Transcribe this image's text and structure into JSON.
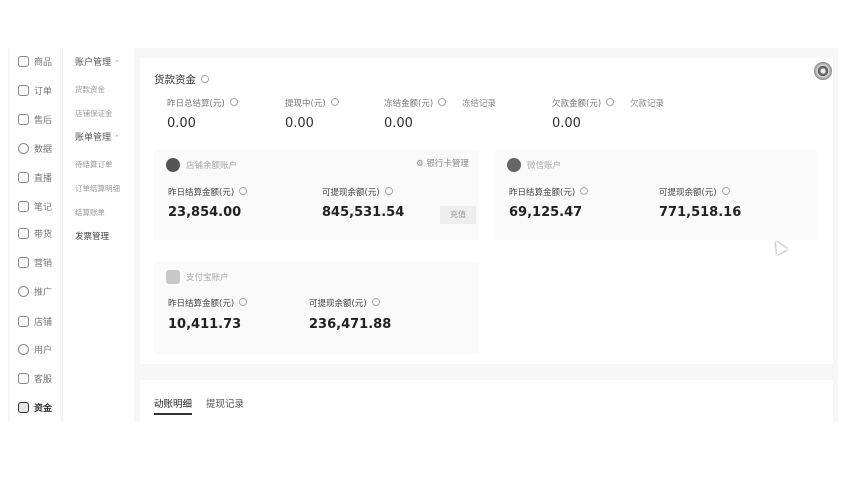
{
  "nav": {
    "items": [
      {
        "label": "商品",
        "icon": "box-icon"
      },
      {
        "label": "订单",
        "icon": "clipboard-icon"
      },
      {
        "label": "售后",
        "icon": "service-icon"
      },
      {
        "label": "数据",
        "icon": "chart-icon"
      },
      {
        "label": "直播",
        "icon": "live-icon"
      },
      {
        "label": "笔记",
        "icon": "book-icon"
      },
      {
        "label": "带货",
        "icon": "lock-icon"
      },
      {
        "label": "营销",
        "icon": "megaphone-icon"
      },
      {
        "label": "推广",
        "icon": "people-icon"
      },
      {
        "label": "店铺",
        "icon": "shop-icon"
      },
      {
        "label": "用户",
        "icon": "user-icon"
      },
      {
        "label": "客服",
        "icon": "chat-icon"
      },
      {
        "label": "资金",
        "icon": "wallet-icon"
      }
    ]
  },
  "submenu": {
    "account_head": "账户管理",
    "account_items": [
      "货款资金",
      "店铺保证金"
    ],
    "bill_head": "账单管理",
    "bill_items": [
      "待结算订单",
      "订单结算明细",
      "结算账单"
    ],
    "invoice": "发票管理"
  },
  "funds": {
    "title": "货款资金",
    "metrics": [
      {
        "label": "昨日总结算(元)",
        "value": "0.00"
      },
      {
        "label": "提现中(元)",
        "value": "0.00"
      },
      {
        "label": "冻结金额(元)",
        "value": "0.00"
      },
      {
        "label": "欠款金额(元)",
        "value": "0.00"
      }
    ],
    "freeze_link": "冻结记录",
    "debt_link": "欠款记录"
  },
  "shop_account": {
    "name": "店铺余额账户",
    "bank_link": "银行卡管理",
    "settle_label": "昨日结算金额(元)",
    "settle_value": "23,854.00",
    "withdraw_label": "可提现余额(元)",
    "withdraw_value": "845,531.54",
    "recharge": "充值"
  },
  "wechat_account": {
    "name": "微信账户",
    "settle_label": "昨日结算金额(元)",
    "settle_value": "69,125.47",
    "withdraw_label": "可提现余额(元)",
    "withdraw_value": "771,518.16"
  },
  "alipay_account": {
    "name": "支付宝账户",
    "settle_label": "昨日结算金额(元)",
    "settle_value": "10,411.73",
    "withdraw_label": "可提现余额(元)",
    "withdraw_value": "236,471.88"
  },
  "tabs": [
    "动账明细",
    "提现记录"
  ]
}
